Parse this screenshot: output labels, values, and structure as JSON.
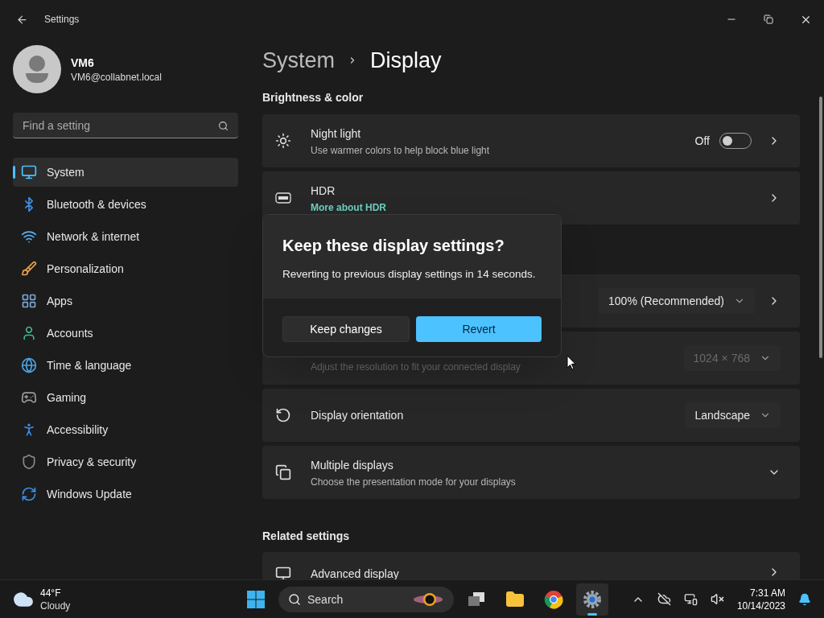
{
  "window": {
    "title": "Settings"
  },
  "user": {
    "name": "VM6",
    "email": "VM6@collabnet.local"
  },
  "search": {
    "placeholder": "Find a setting"
  },
  "nav": [
    {
      "label": "System",
      "selected": true
    },
    {
      "label": "Bluetooth & devices",
      "selected": false
    },
    {
      "label": "Network & internet",
      "selected": false
    },
    {
      "label": "Personalization",
      "selected": false
    },
    {
      "label": "Apps",
      "selected": false
    },
    {
      "label": "Accounts",
      "selected": false
    },
    {
      "label": "Time & language",
      "selected": false
    },
    {
      "label": "Gaming",
      "selected": false
    },
    {
      "label": "Accessibility",
      "selected": false
    },
    {
      "label": "Privacy & security",
      "selected": false
    },
    {
      "label": "Windows Update",
      "selected": false
    }
  ],
  "breadcrumb": [
    "System",
    "Display"
  ],
  "sections": [
    {
      "heading": "Brightness & color",
      "rows": [
        {
          "kind": "toggle",
          "title": "Night light",
          "description": "Use warmer colors to help block blue light",
          "state_label": "Off",
          "on": false
        },
        {
          "kind": "link",
          "title": "HDR",
          "link": "More about HDR"
        }
      ]
    },
    {
      "rows": [
        {
          "kind": "dropdown",
          "value": "100% (Recommended)",
          "disabled": false,
          "chevron": true
        },
        {
          "kind": "dropdown",
          "value": "1024 × 768",
          "description": "Adjust the resolution to fit your connected display",
          "disabled": true
        },
        {
          "kind": "dropdown",
          "title": "Display orientation",
          "value": "Landscape",
          "disabled": false
        },
        {
          "kind": "expand",
          "title": "Multiple displays",
          "description": "Choose the presentation mode for your displays",
          "expanded": false
        }
      ]
    },
    {
      "heading": "Related settings",
      "rows": [
        {
          "kind": "link",
          "title": "Advanced display"
        }
      ]
    }
  ],
  "dialog": {
    "title": "Keep these display settings?",
    "message": "Reverting to previous display settings in 14 seconds.",
    "buttons": [
      {
        "label": "Keep changes",
        "primary": false
      },
      {
        "label": "Revert",
        "primary": true
      }
    ]
  },
  "taskbar": {
    "weather": {
      "temperature": "44°F",
      "condition": "Cloudy"
    },
    "search": {
      "placeholder": "Search"
    },
    "clock": {
      "time": "7:31 AM",
      "date": "10/14/2023"
    }
  }
}
